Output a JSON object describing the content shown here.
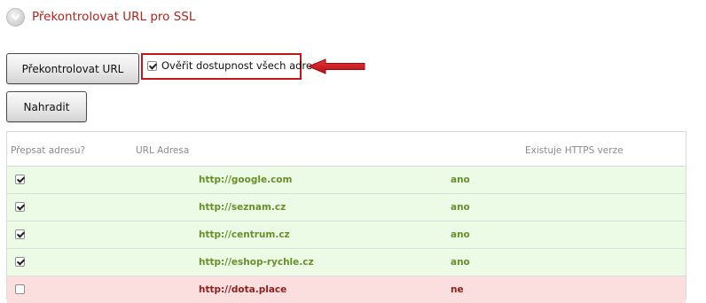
{
  "header": {
    "title": "Překontrolovat URL pro SSL",
    "icon": "chevron-down-circle-icon"
  },
  "actions": {
    "recheck_label": "Překontrolovat URL",
    "replace_label": "Nahradit",
    "verify_all_label": "Ověřit dostupnost všech adres",
    "verify_all_checked": true
  },
  "annotation": {
    "icon": "red-arrow-left-icon",
    "color": "#c8151b"
  },
  "table": {
    "columns": {
      "rewrite": "Přepsat adresu?",
      "url": "URL Adresa",
      "https": "Existuje HTTPS verze"
    },
    "rows": [
      {
        "checked": true,
        "url": "http://google.com",
        "https": "ano",
        "status": "ok"
      },
      {
        "checked": true,
        "url": "http://seznam.cz",
        "https": "ano",
        "status": "ok"
      },
      {
        "checked": true,
        "url": "http://centrum.cz",
        "https": "ano",
        "status": "ok"
      },
      {
        "checked": true,
        "url": "http://eshop-rychle.cz",
        "https": "ano",
        "status": "ok"
      },
      {
        "checked": false,
        "url": "http://dota.place",
        "https": "ne",
        "status": "bad"
      }
    ]
  },
  "colors": {
    "title": "#b3241b",
    "row_ok_bg": "#ecfbe6",
    "row_ok_text": "#67902b",
    "row_bad_bg": "#fbdede",
    "row_bad_text": "#8c1f1f"
  }
}
